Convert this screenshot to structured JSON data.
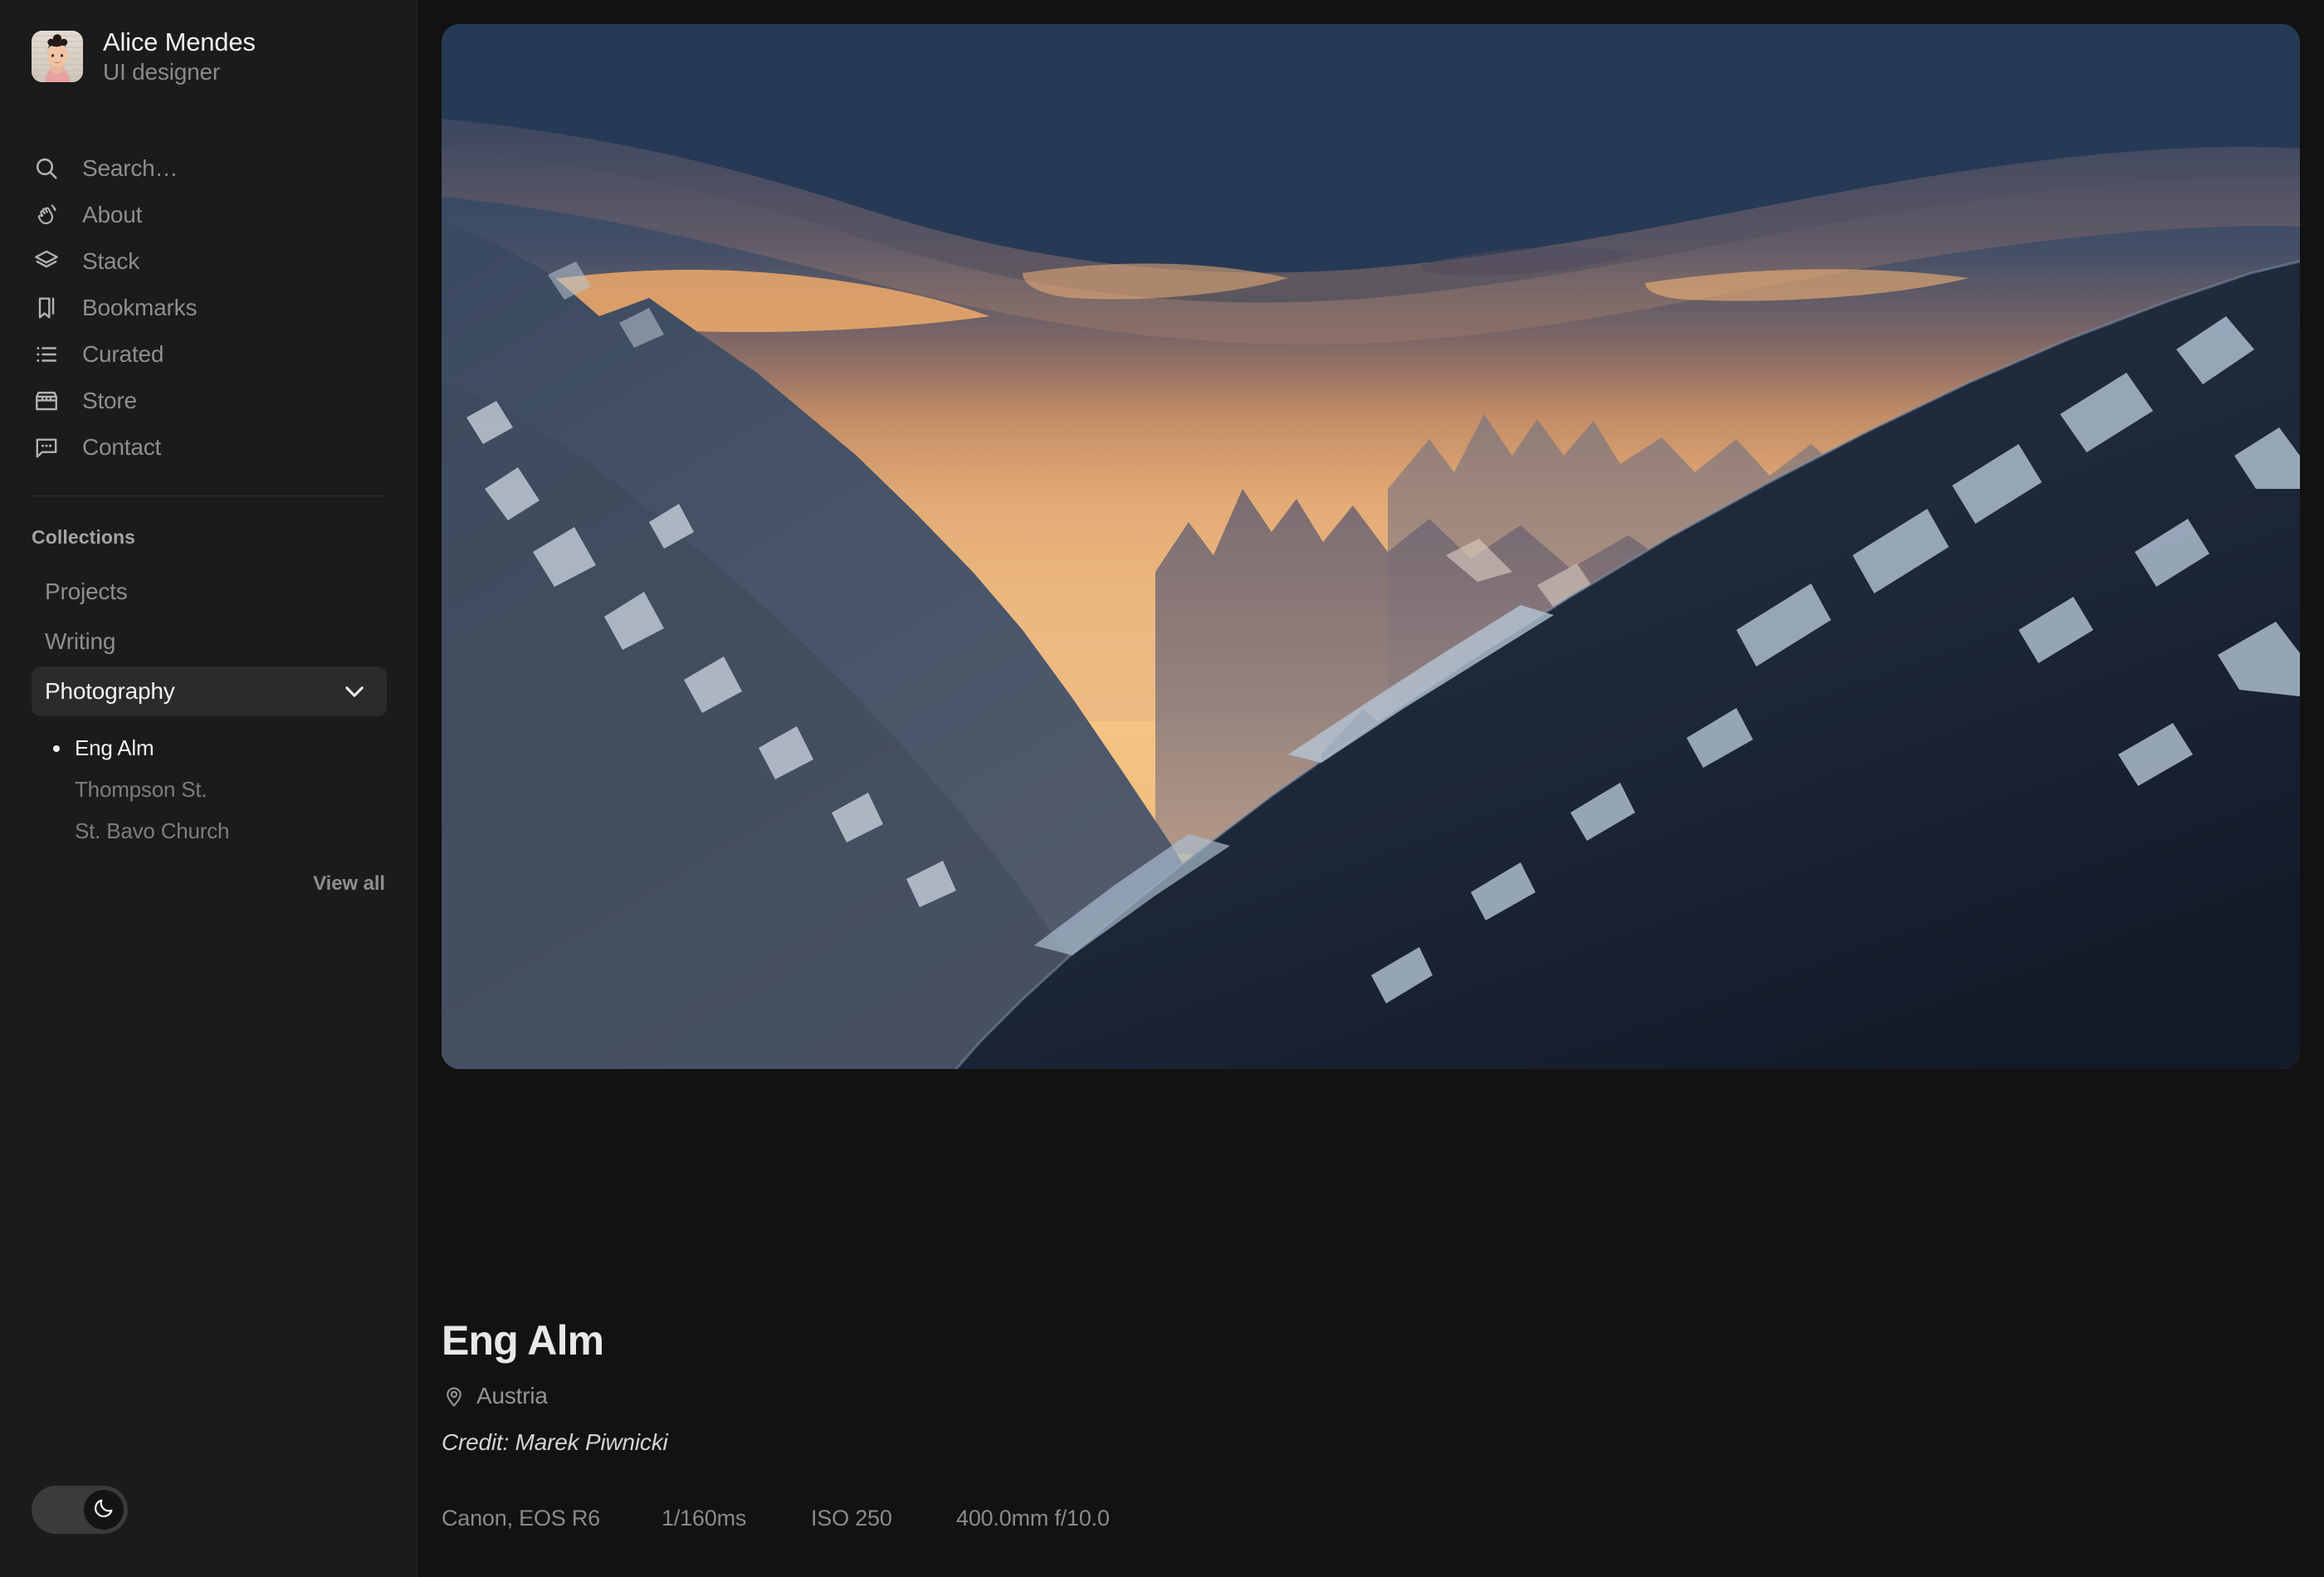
{
  "profile": {
    "name": "Alice Mendes",
    "role": "UI designer",
    "avatar_icon": "user-photo-avatar"
  },
  "nav": {
    "items": [
      {
        "label": "Search…",
        "icon": "search-icon",
        "key": "search"
      },
      {
        "label": "About",
        "icon": "waving-hand-icon",
        "key": "about"
      },
      {
        "label": "Stack",
        "icon": "layers-icon",
        "key": "stack"
      },
      {
        "label": "Bookmarks",
        "icon": "bookmark-icon",
        "key": "bookmarks"
      },
      {
        "label": "Curated",
        "icon": "list-icon",
        "key": "curated"
      },
      {
        "label": "Store",
        "icon": "storefront-icon",
        "key": "store"
      },
      {
        "label": "Contact",
        "icon": "chat-bubble-icon",
        "key": "contact"
      }
    ]
  },
  "collections": {
    "heading": "Collections",
    "items": [
      {
        "label": "Projects",
        "active": false
      },
      {
        "label": "Writing",
        "active": false
      },
      {
        "label": "Photography",
        "active": true,
        "expanded": true,
        "icon": "chevron-down-icon"
      }
    ],
    "sub_items": [
      {
        "label": "Eng Alm",
        "active": true
      },
      {
        "label": "Thompson St.",
        "active": false
      },
      {
        "label": "St. Bavo Church",
        "active": false
      }
    ],
    "view_all_label": "View all"
  },
  "theme_toggle": {
    "state": "dark",
    "icon": "moon-icon"
  },
  "photo": {
    "alt": "Mountain ridges at sunset, Eng Alm, Austria",
    "title": "Eng Alm",
    "location": "Austria",
    "location_icon": "map-pin-icon",
    "credit": "Credit: Marek Piwnicki",
    "exif": [
      "Canon, EOS R6",
      "1/160ms",
      "ISO 250",
      "400.0mm f/10.0"
    ],
    "colors": {
      "sky_top": "#27405e",
      "sky_mid": "#e8a86a",
      "sky_glow": "#f6c183",
      "haze": "#c9a392",
      "ridge_dark": "#1e2b3c",
      "ridge_far": "#8c7d7b",
      "snow": "#c3cfdd"
    }
  },
  "theme": {
    "page_bg": "#121212",
    "sidebar_bg": "#1b1b1b",
    "text_primary": "#efefef",
    "text_muted": "#8e8e8e",
    "active_bg": "#2b2b2b"
  }
}
